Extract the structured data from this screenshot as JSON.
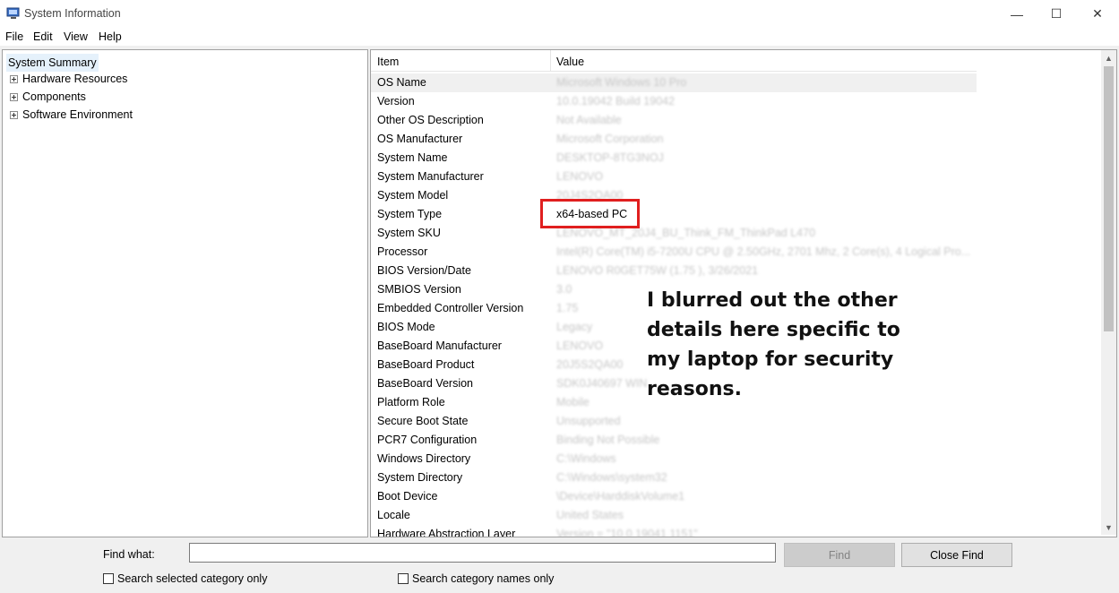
{
  "window": {
    "title": "System Information",
    "minimize_glyph": "—",
    "maximize_glyph": "☐",
    "close_glyph": "✕"
  },
  "menu": [
    "File",
    "Edit",
    "View",
    "Help"
  ],
  "tree": {
    "root": "System Summary",
    "children": [
      "Hardware Resources",
      "Components",
      "Software Environment"
    ]
  },
  "list": {
    "columns": [
      "Item",
      "Value"
    ],
    "rows": [
      {
        "item": "OS Name",
        "value": "Microsoft Windows 10 Pro"
      },
      {
        "item": "Version",
        "value": "10.0.19042 Build 19042"
      },
      {
        "item": "Other OS Description",
        "value": "Not Available"
      },
      {
        "item": "OS Manufacturer",
        "value": "Microsoft Corporation"
      },
      {
        "item": "System Name",
        "value": "DESKTOP-8TG3NOJ"
      },
      {
        "item": "System Manufacturer",
        "value": "LENOVO"
      },
      {
        "item": "System Model",
        "value": "20J4S2QA00"
      },
      {
        "item": "System Type",
        "value": "x64-based PC"
      },
      {
        "item": "System SKU",
        "value": "LENOVO_MT_20J4_BU_Think_FM_ThinkPad L470"
      },
      {
        "item": "Processor",
        "value": "Intel(R) Core(TM) i5-7200U CPU @ 2.50GHz, 2701 Mhz, 2 Core(s), 4 Logical Pro..."
      },
      {
        "item": "BIOS Version/Date",
        "value": "LENOVO R0GET75W (1.75 ), 3/26/2021"
      },
      {
        "item": "SMBIOS Version",
        "value": "3.0"
      },
      {
        "item": "Embedded Controller Version",
        "value": "1.75"
      },
      {
        "item": "BIOS Mode",
        "value": "Legacy"
      },
      {
        "item": "BaseBoard Manufacturer",
        "value": "LENOVO"
      },
      {
        "item": "BaseBoard Product",
        "value": "20J5S2QA00"
      },
      {
        "item": "BaseBoard Version",
        "value": "SDK0J40697 WIN"
      },
      {
        "item": "Platform Role",
        "value": "Mobile"
      },
      {
        "item": "Secure Boot State",
        "value": "Unsupported"
      },
      {
        "item": "PCR7 Configuration",
        "value": "Binding Not Possible"
      },
      {
        "item": "Windows Directory",
        "value": "C:\\Windows"
      },
      {
        "item": "System Directory",
        "value": "C:\\Windows\\system32"
      },
      {
        "item": "Boot Device",
        "value": "\\Device\\HarddiskVolume1"
      },
      {
        "item": "Locale",
        "value": "United States"
      },
      {
        "item": "Hardware Abstraction Layer",
        "value": "Version = \"10.0.19041.1151\""
      }
    ]
  },
  "annotation": {
    "note": "I blurred out the other details here specific to my laptop for security reasons.",
    "highlight_color": "#e01f1f"
  },
  "find": {
    "label": "Find what:",
    "value": "",
    "find_button": "Find",
    "close_button": "Close Find",
    "check_selected": "Search selected category only",
    "check_names": "Search category names only"
  }
}
